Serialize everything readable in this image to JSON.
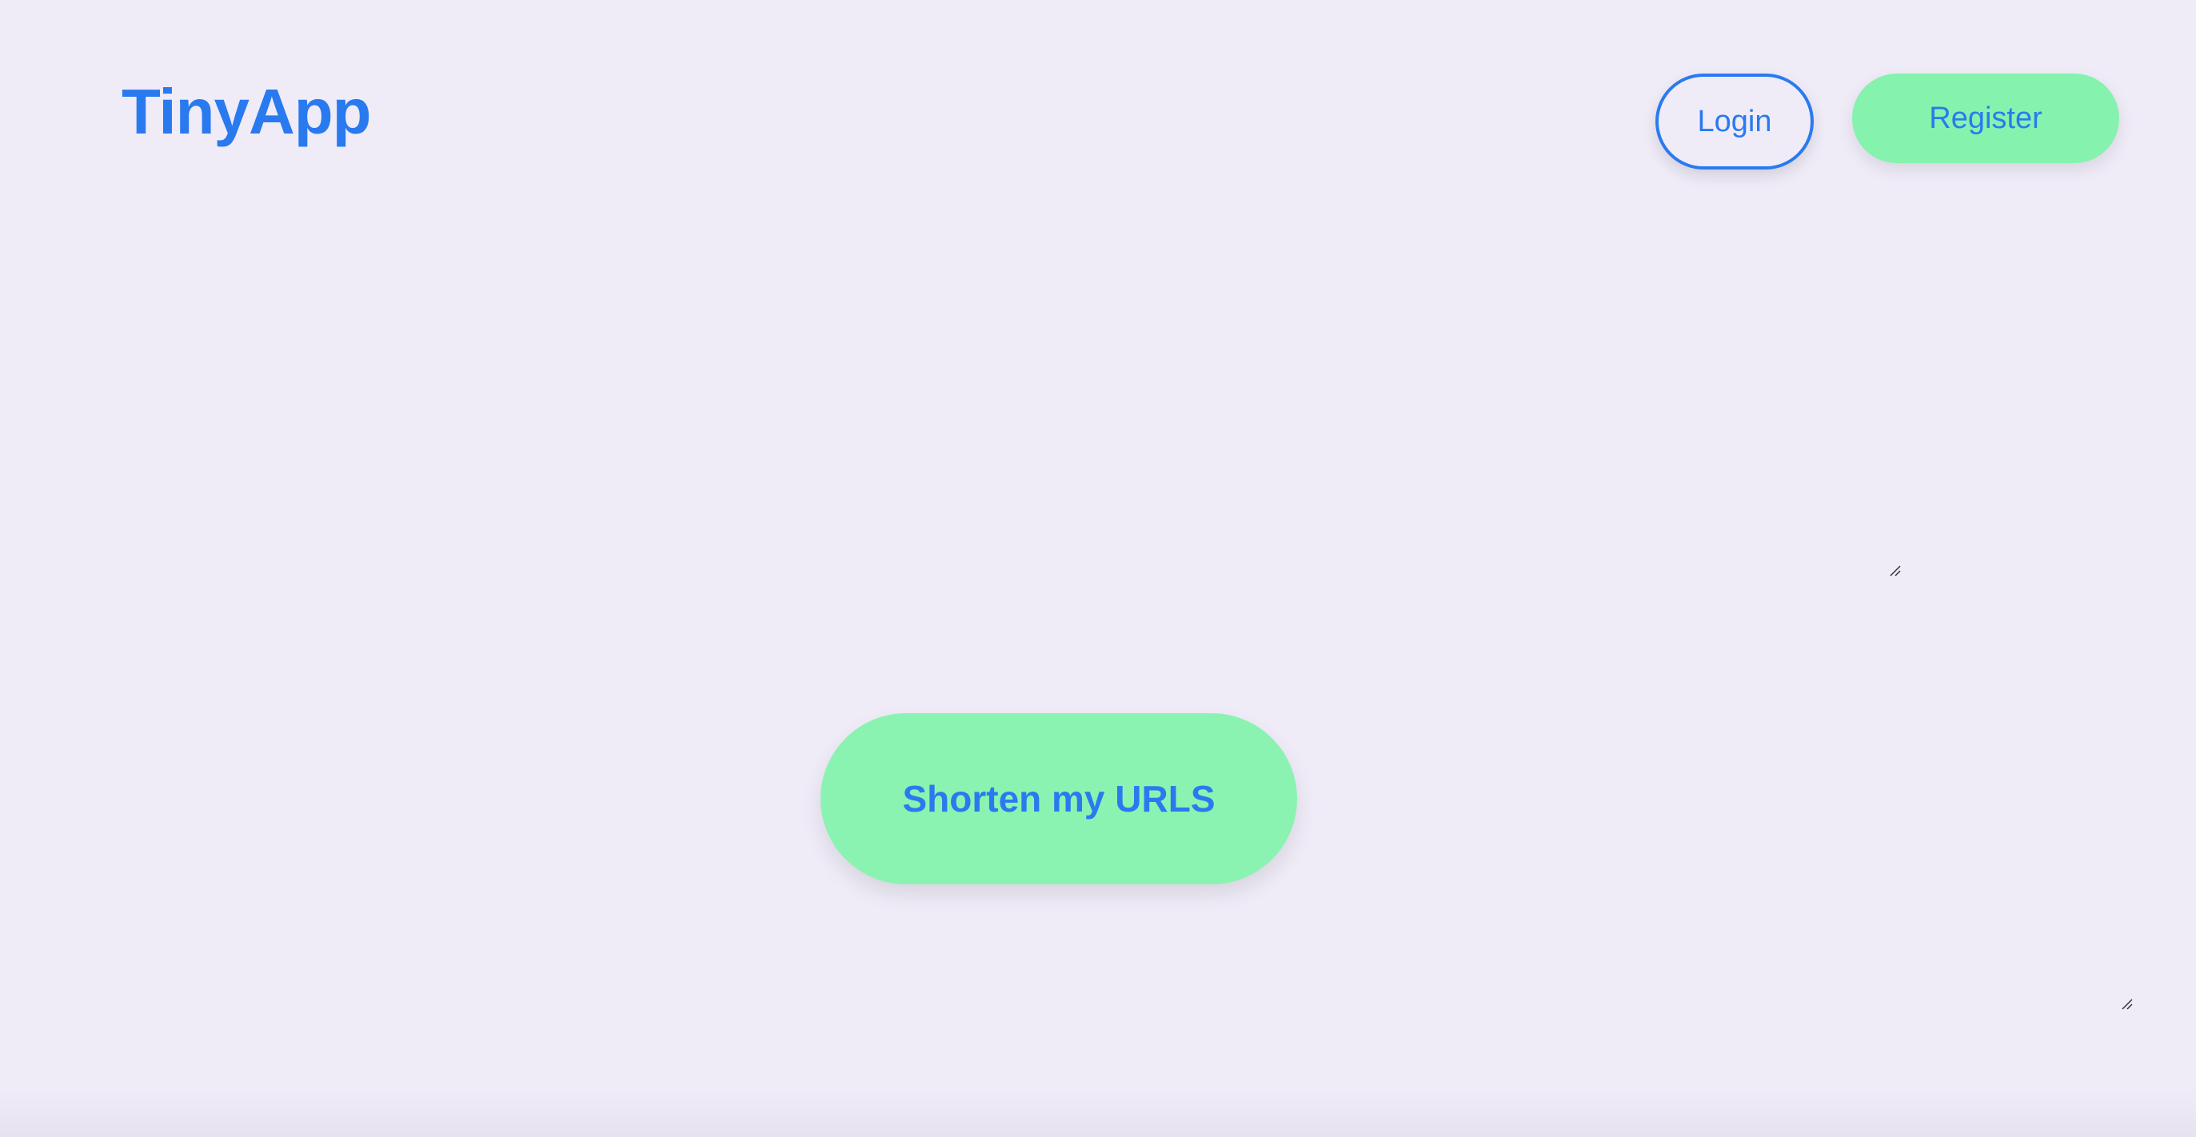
{
  "header": {
    "brand": "TinyApp",
    "login_label": "Login",
    "register_label": "Register"
  },
  "main": {
    "shorten_label": "Shorten my URLS"
  },
  "colors": {
    "background": "#efecf8",
    "accent": "#2a7aef",
    "button_green": "#85f2ad"
  },
  "icons": {
    "resize_handle": "textarea-resize-handle-icon"
  }
}
